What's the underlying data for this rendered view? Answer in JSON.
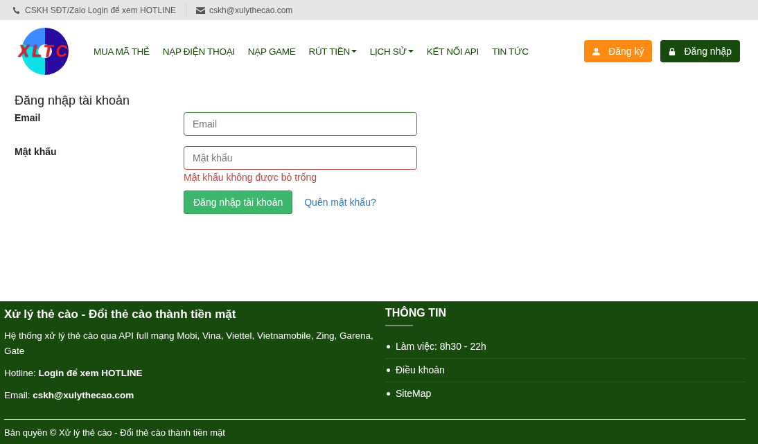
{
  "topbar": {
    "phone": "CSKH SĐT/Zalo Login để xem HOTLINE",
    "email": "cskh@xulythecao.com"
  },
  "logo": {
    "text": "XLTC"
  },
  "nav": [
    {
      "label": "MUA MÃ THẺ",
      "dropdown": false
    },
    {
      "label": "NẠP ĐIỆN THOẠI",
      "dropdown": false
    },
    {
      "label": "NẠP GAME",
      "dropdown": false
    },
    {
      "label": "RÚT TIỀN",
      "dropdown": true
    },
    {
      "label": "LỊCH SỬ",
      "dropdown": true
    },
    {
      "label": "KẾT NỐI API",
      "dropdown": false
    },
    {
      "label": "TIN TỨC",
      "dropdown": false
    }
  ],
  "auth_buttons": [
    {
      "kind": "register",
      "label": "Đăng ký"
    },
    {
      "kind": "login",
      "label": "Đăng nhập"
    }
  ],
  "form": {
    "title": "Đăng nhập tài khoản",
    "fields": [
      {
        "label": "Email",
        "placeholder": "Email",
        "invalid": false
      },
      {
        "label": "Mật khẩu",
        "placeholder": "Mật khẩu",
        "invalid": true,
        "error": "Mật khẩu không được bỏ trống"
      }
    ],
    "submit": "Đăng nhập tài khoản",
    "forgot": "Quên mật khẩu?"
  },
  "footer": {
    "title": "Xử lý thẻ cào - Đổi thẻ cào thành tiền mặt",
    "description": "Hệ thống xử lý thẻ cào qua API full mạng Mobi, Vina, Viettel, Vietnamobile, Zing, Garena, Gate",
    "hotline": "Hotline: **Login để xem HOTLINE**",
    "email": "Email: **cskh@xulythecao.com**",
    "info_title": "THÔNG TIN",
    "info_items": [
      "Làm việc: 8h30 - 22h",
      "Điều khoản",
      "SiteMap"
    ],
    "copyright": "Bản quyền © Xử lý thẻ cào - Đổi thẻ cào thành tiền mặt"
  }
}
